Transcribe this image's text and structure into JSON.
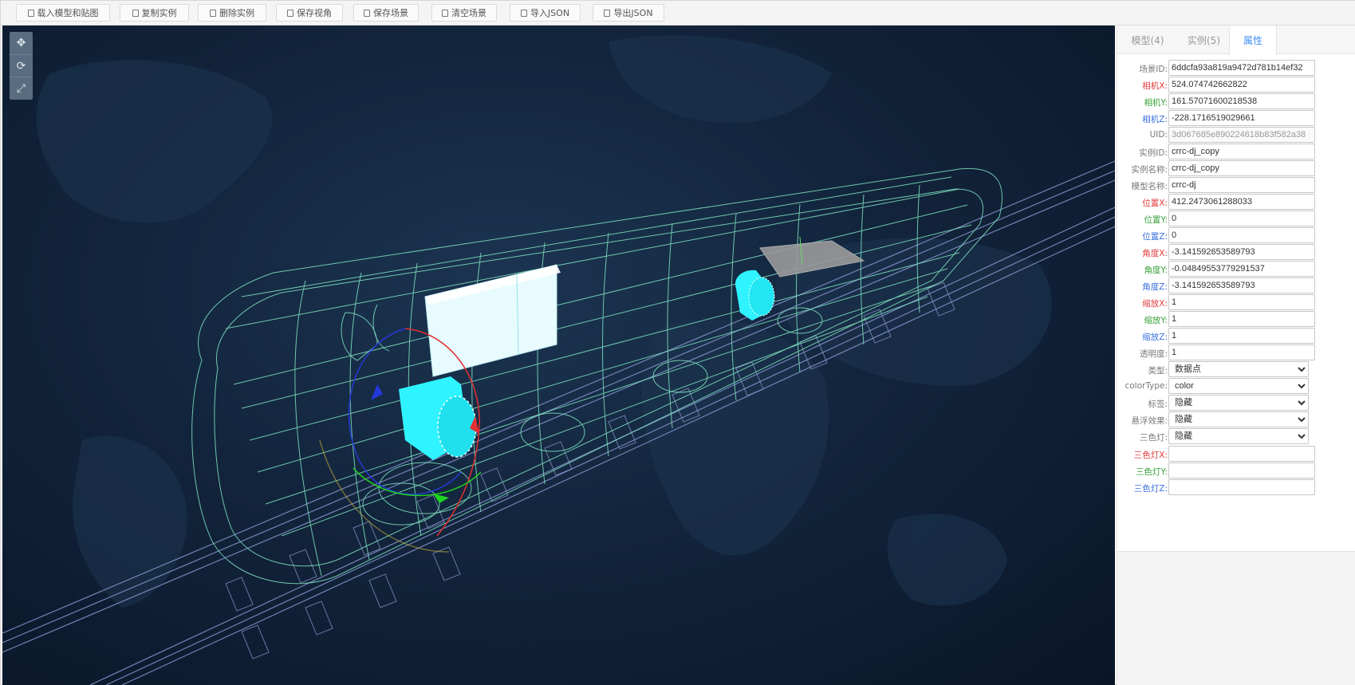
{
  "toolbar": {
    "buttons": [
      {
        "label": "载入模型和贴图",
        "icon": "file-icon"
      },
      {
        "label": "复制实例",
        "icon": "copy-icon"
      },
      {
        "label": "删除实例",
        "icon": "trash-icon"
      },
      {
        "label": "保存视角",
        "icon": "save-view-icon"
      },
      {
        "label": "保存场景",
        "icon": "save-icon"
      },
      {
        "label": "清空场景",
        "icon": "clear-icon"
      },
      {
        "label": "导入JSON",
        "icon": "import-icon"
      },
      {
        "label": "导出JSON",
        "icon": "export-icon"
      }
    ]
  },
  "viewport": {
    "tools": [
      "move-tool-icon",
      "rotate-tool-icon",
      "scale-tool-icon"
    ],
    "tool_glyphs": [
      "✥",
      "⟳",
      "⤢"
    ]
  },
  "panel": {
    "tabs": [
      "模型(4)",
      "实例(5)",
      "属性"
    ],
    "active_tab": "属性",
    "accent": "#3e8ef7",
    "fields": {
      "scene_id": {
        "label": "场景ID:",
        "value": "6ddcfa93a819a9472d781b14ef32"
      },
      "camera_x": {
        "label": "相机X:",
        "value": "524.074742662822"
      },
      "camera_y": {
        "label": "相机Y:",
        "value": "161.57071600218538"
      },
      "camera_z": {
        "label": "相机Z:",
        "value": "-228.1716519029661"
      },
      "uid": {
        "label": "UID:",
        "value": "3d067685e890224618b83f582a38"
      },
      "instance_id": {
        "label": "实例ID:",
        "value": "crrc-dj_copy"
      },
      "instance_name": {
        "label": "实例名称:",
        "value": "crrc-dj_copy"
      },
      "model_name": {
        "label": "模型名称:",
        "value": "crrc-dj"
      },
      "pos_x": {
        "label": "位置X:",
        "value": "412.2473061288033"
      },
      "pos_y": {
        "label": "位置Y:",
        "value": "0"
      },
      "pos_z": {
        "label": "位置Z:",
        "value": "0"
      },
      "angle_x": {
        "label": "角度X:",
        "value": "-3.141592653589793"
      },
      "angle_y": {
        "label": "角度Y:",
        "value": "-0.04849553779291537"
      },
      "angle_z": {
        "label": "角度Z:",
        "value": "-3.141592653589793"
      },
      "scale_x": {
        "label": "缩放X:",
        "value": "1"
      },
      "scale_y": {
        "label": "缩放Y:",
        "value": "1"
      },
      "scale_z": {
        "label": "缩放Z:",
        "value": "1"
      },
      "opacity": {
        "label": "透明度:",
        "value": "1"
      },
      "type": {
        "label": "类型:",
        "value": "数据点"
      },
      "color_type": {
        "label": "colorType:",
        "value": "color"
      },
      "tag": {
        "label": "标签:",
        "value": "隐藏"
      },
      "float_effect": {
        "label": "悬浮效果:",
        "value": "隐藏"
      },
      "tri_light": {
        "label": "三色灯:",
        "value": "隐藏"
      },
      "tri_light_x": {
        "label": "三色灯X:",
        "value": ""
      },
      "tri_light_y": {
        "label": "三色灯Y:",
        "value": ""
      },
      "tri_light_z": {
        "label": "三色灯Z:",
        "value": ""
      }
    },
    "label_colors": {
      "neutral": "#777777",
      "x": "#e03c3c",
      "y": "#3aa23a",
      "z": "#3c6fe0"
    }
  }
}
